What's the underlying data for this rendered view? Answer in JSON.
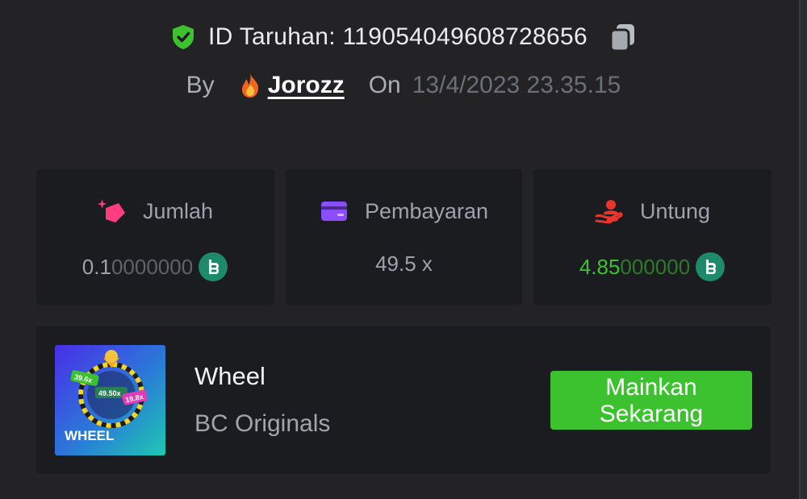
{
  "header": {
    "bet_id_label": "ID Taruhan:",
    "bet_id_value": "119054049608728656",
    "by_label": "By",
    "username": "Jorozz",
    "on_label": "On",
    "date": "13/4/2023 23.35.15"
  },
  "stats": {
    "amount": {
      "label": "Jumlah",
      "value_main": "0.1",
      "value_trailing": "0000000",
      "icon": "coin-icon"
    },
    "payout": {
      "label": "Pembayaran",
      "value": "49.5 x"
    },
    "profit": {
      "label": "Untung",
      "value_main": "4.85",
      "value_trailing": "000000",
      "icon": "coin-icon"
    }
  },
  "game": {
    "thumb_title": "WHEEL",
    "thumb_badges": [
      "39.6x",
      "49.50x",
      "19.8x"
    ],
    "name": "Wheel",
    "provider": "BC Originals",
    "play_button": "Mainkan Sekarang"
  },
  "colors": {
    "background": "#232326",
    "card": "#1b1c1f",
    "accent_green": "#3cc12f",
    "coin": "#1e8a6a"
  }
}
